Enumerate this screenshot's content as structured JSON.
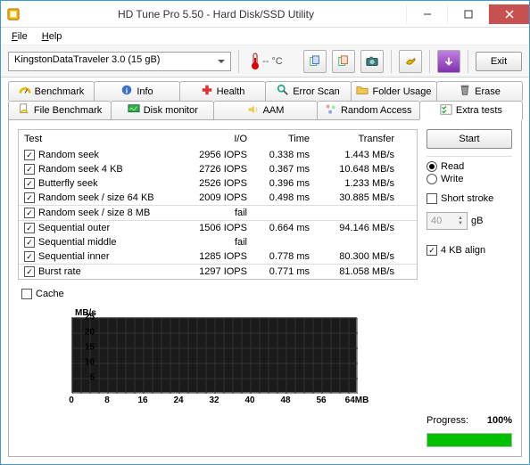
{
  "window": {
    "title": "HD Tune Pro 5.50 - Hard Disk/SSD Utility"
  },
  "menu": {
    "file": "File",
    "help": "Help"
  },
  "toolbar": {
    "drive": "KingstonDataTraveler 3.0 (15 gB)",
    "temp": "-- °C",
    "exit": "Exit"
  },
  "tabs": {
    "row1": [
      {
        "label": "Benchmark"
      },
      {
        "label": "Info"
      },
      {
        "label": "Health"
      },
      {
        "label": "Error Scan"
      },
      {
        "label": "Folder Usage"
      },
      {
        "label": "Erase"
      }
    ],
    "row2": [
      {
        "label": "File Benchmark"
      },
      {
        "label": "Disk monitor"
      },
      {
        "label": "AAM"
      },
      {
        "label": "Random Access"
      },
      {
        "label": "Extra tests"
      }
    ]
  },
  "table": {
    "cols": {
      "test": "Test",
      "io": "I/O",
      "time": "Time",
      "transfer": "Transfer"
    },
    "rows": [
      {
        "checked": true,
        "name": "Random seek",
        "io": "2956 IOPS",
        "time": "0.338 ms",
        "transfer": "1.443 MB/s",
        "sep": false
      },
      {
        "checked": true,
        "name": "Random seek 4 KB",
        "io": "2726 IOPS",
        "time": "0.367 ms",
        "transfer": "10.648 MB/s",
        "sep": false
      },
      {
        "checked": true,
        "name": "Butterfly seek",
        "io": "2526 IOPS",
        "time": "0.396 ms",
        "transfer": "1.233 MB/s",
        "sep": false
      },
      {
        "checked": true,
        "name": "Random seek / size 64 KB",
        "io": "2009 IOPS",
        "time": "0.498 ms",
        "transfer": "30.885 MB/s",
        "sep": false
      },
      {
        "checked": true,
        "name": "Random seek / size 8 MB",
        "io": "fail",
        "time": "",
        "transfer": "",
        "sep": true
      },
      {
        "checked": true,
        "name": "Sequential outer",
        "io": "1506 IOPS",
        "time": "0.664 ms",
        "transfer": "94.146 MB/s",
        "sep": true
      },
      {
        "checked": true,
        "name": "Sequential middle",
        "io": "fail",
        "time": "",
        "transfer": "",
        "sep": false
      },
      {
        "checked": true,
        "name": "Sequential inner",
        "io": "1285 IOPS",
        "time": "0.778 ms",
        "transfer": "80.300 MB/s",
        "sep": false
      },
      {
        "checked": true,
        "name": "Burst rate",
        "io": "1297 IOPS",
        "time": "0.771 ms",
        "transfer": "81.058 MB/s",
        "sep": true
      }
    ]
  },
  "cache_label": "Cache",
  "right": {
    "start": "Start",
    "read": "Read",
    "write": "Write",
    "short_stroke": "Short stroke",
    "stroke_value": "40",
    "stroke_unit": "gB",
    "align": "4 KB align",
    "progress_label": "Progress:",
    "progress_value": "100%",
    "progress_pct": 100
  },
  "chart_data": {
    "type": "line",
    "title": "",
    "xlabel": "MB",
    "ylabel": "MB/s",
    "xlim": [
      0,
      64
    ],
    "ylim": [
      0,
      25
    ],
    "xticks": [
      0,
      8,
      16,
      24,
      32,
      40,
      48,
      56,
      64
    ],
    "xtick_labels": [
      "0",
      "8",
      "16",
      "24",
      "32",
      "40",
      "48",
      "56",
      "64MB"
    ],
    "yticks": [
      5,
      10,
      15,
      20,
      25
    ],
    "series": []
  }
}
